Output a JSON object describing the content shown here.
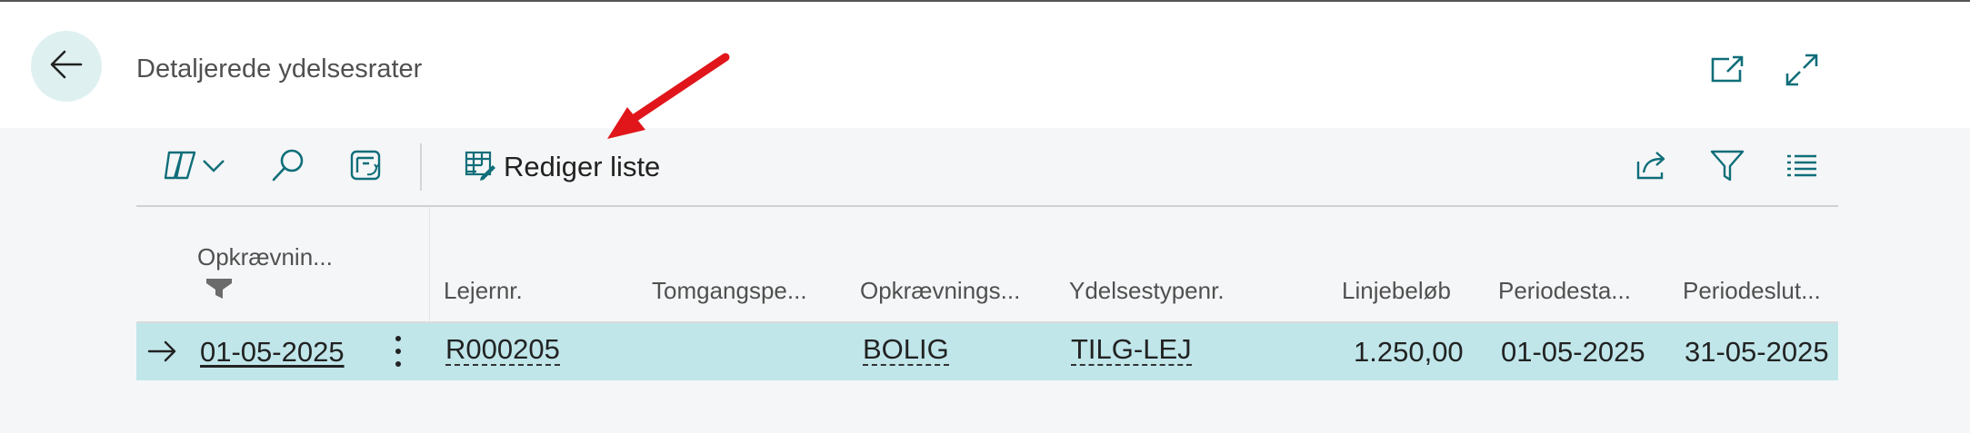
{
  "page": {
    "title": "Detaljerede ydelsesrater"
  },
  "header": {
    "back_icon": "arrow-left-icon",
    "open_new_window_icon": "open-in-new-window-icon",
    "expand_icon": "expand-icon"
  },
  "toolbar": {
    "copilot_icon": "copilot-icon",
    "search_icon": "search-icon",
    "views_icon": "view-switch-icon",
    "edit_list_label": "Rediger liste",
    "share_icon": "share-icon",
    "filter_icon": "filter-icon",
    "list_view_icon": "list-options-icon"
  },
  "columns": [
    "Opkrævnin...",
    "Lejernr.",
    "Tomgangspe...",
    "Opkrævnings...",
    "Ydelsestypenr.",
    "Linjebeløb",
    "Periodesta...",
    "Periodeslut..."
  ],
  "rows": [
    {
      "date": "01-05-2025",
      "tenant_no": "R000205",
      "vacancy": "",
      "charge_type": "BOLIG",
      "benefit_type": "TILG-LEJ",
      "amount": "1.250,00",
      "period_start": "01-05-2025",
      "period_end": "31-05-2025"
    }
  ],
  "colors": {
    "accent": "#0f6e79",
    "selected_row": "#c0e6ea",
    "annotation_arrow": "#e0161b"
  }
}
